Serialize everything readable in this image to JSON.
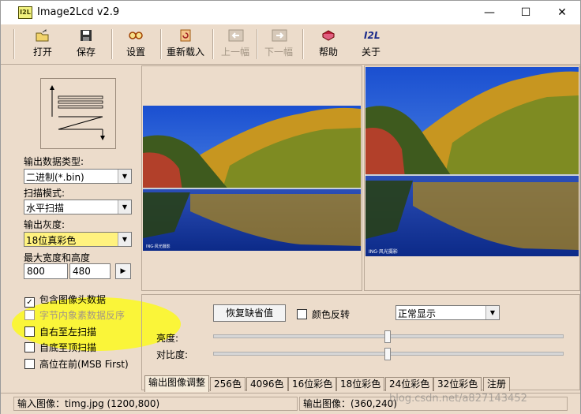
{
  "window": {
    "title": "Image2Lcd v2.9",
    "app_icon_text": "I2L"
  },
  "toolbar": {
    "open": "打开",
    "save": "保存",
    "settings": "设置",
    "reload": "重新载入",
    "prev": "上一幅",
    "next": "下一幅",
    "help": "帮助",
    "about": "关于",
    "about_icon_text": "I2L"
  },
  "left": {
    "output_type_label": "输出数据类型:",
    "output_type_value": "二进制(*.bin)",
    "scan_mode_label": "扫描模式:",
    "scan_mode_value": "水平扫描",
    "gray_label": "输出灰度:",
    "gray_value": "18位真彩色",
    "max_size_label": "最大宽度和高度",
    "max_width": "800",
    "max_height": "480",
    "checks": [
      {
        "label": "包含图像头数据",
        "checked": true,
        "disabled": false
      },
      {
        "label": "字节内象素数据反序",
        "checked": false,
        "disabled": true
      },
      {
        "label": "自右至左扫描",
        "checked": false,
        "disabled": false
      },
      {
        "label": "自底至顶扫描",
        "checked": false,
        "disabled": false
      },
      {
        "label": "高位在前(MSB First)",
        "checked": false,
        "disabled": false
      }
    ]
  },
  "controls": {
    "restore_button": "恢复缺省值",
    "invert_label": "颜色反转",
    "display_mode": "正常显示",
    "brightness_label": "亮度:",
    "contrast_label": "对比度:",
    "brightness_value": 0.5,
    "contrast_value": 0.5
  },
  "tabs": [
    "输出图像调整",
    "256色",
    "4096色",
    "16位彩色",
    "18位彩色",
    "24位彩色",
    "32位彩色",
    "注册"
  ],
  "status": {
    "input": "输入图像：timg.jpg (1200,800)",
    "output": "输出图像：(360,240)"
  },
  "photo_watermark": "ING·风光摄影",
  "watermark": "blog.csdn.net/a827143452",
  "colors": {
    "highlight": "#ffff00",
    "background": "#ecdccb"
  }
}
